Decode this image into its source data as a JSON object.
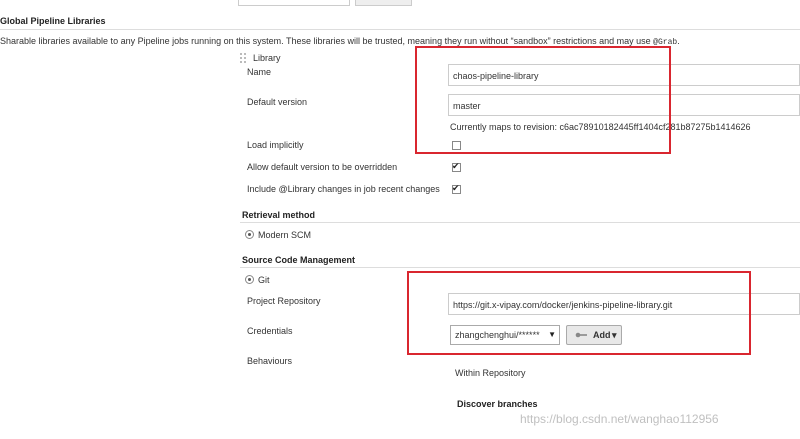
{
  "section": {
    "title": "Global Pipeline Libraries",
    "description": "Sharable libraries available to any Pipeline jobs running on this system. These libraries will be trusted, meaning they run without “sandbox” restrictions and may use ",
    "description_code": "@Grab",
    "description_end": "."
  },
  "library": {
    "header_label": "Library",
    "name_label": "Name",
    "name_value": "chaos-pipeline-library",
    "default_version_label": "Default version",
    "default_version_value": "master",
    "revision_note": "Currently maps to revision: c6ac78910182445ff1404cf281b87275b1414626",
    "load_implicitly_label": "Load implicitly",
    "load_implicitly_checked": false,
    "allow_override_label": "Allow default version to be overridden",
    "allow_override_checked": true,
    "include_changes_label": "Include @Library changes in job recent changes",
    "include_changes_checked": true,
    "checkmark": "✔"
  },
  "retrieval": {
    "heading": "Retrieval method",
    "option_label": "Modern SCM"
  },
  "scm": {
    "heading": "Source Code Management",
    "option_label": "Git",
    "repo_label": "Project Repository",
    "repo_value": "https://git.x-vipay.com/docker/jenkins-pipeline-library.git",
    "credentials_label": "Credentials",
    "credentials_value": "zhangchenghui/******",
    "credentials_arrow": "▼",
    "add_button_label": "Add",
    "add_button_arrow": "▾",
    "key_icon": "key-icon",
    "behaviours_label": "Behaviours",
    "within_repository_label": "Within Repository",
    "discover_branches_label": "Discover branches"
  },
  "watermark": "https://blog.csdn.net/wanghao112956",
  "colors": {
    "highlight_border": "#d9262f",
    "text": "#333333",
    "watermark": "#c0c0c0"
  }
}
